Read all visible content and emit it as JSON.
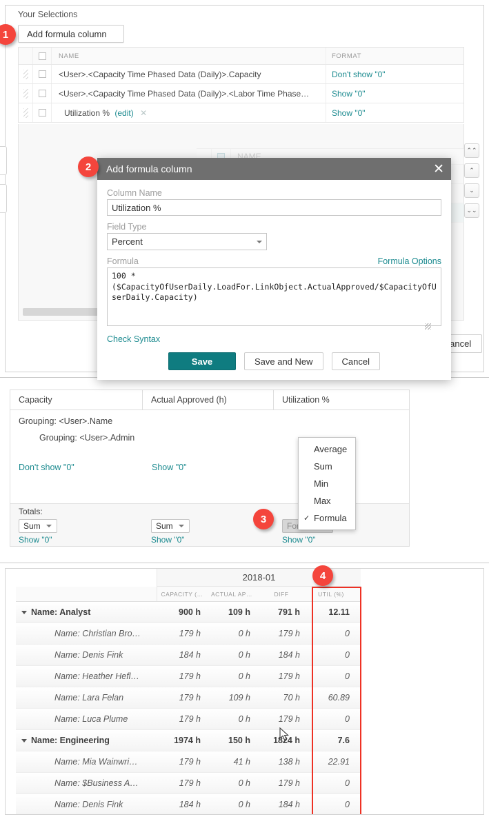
{
  "colors": {
    "accent_teal": "#1b8a8f",
    "save_button": "#0f7c80",
    "badge_red": "#f4453c",
    "highlight_red": "#ee3124",
    "dialog_header": "#6f6f6f"
  },
  "badges": {
    "one": "1",
    "two": "2",
    "three": "3",
    "four": "4"
  },
  "selections": {
    "title": "Your Selections",
    "add_button": "Add formula column",
    "columns": {
      "name": "NAME",
      "format": "FORMAT"
    },
    "rows": [
      {
        "name": "<User>.<Capacity Time Phased Data (Daily)>.Capacity",
        "format": "Don't show \"0\"",
        "edit": "",
        "remove": ""
      },
      {
        "name": "<User>.<Capacity Time Phased Data (Daily)>.<Labor Time Phase…",
        "format": "Show \"0\"",
        "edit": "",
        "remove": ""
      },
      {
        "name": "Utilization %",
        "format": "Show \"0\"",
        "edit": "(edit)",
        "remove": "✕"
      }
    ],
    "ghost_rows": [
      {
        "name": "NAME"
      },
      {
        "name": ""
      },
      {
        "name": ""
      },
      {
        "name": ""
      }
    ],
    "arrows": [
      {
        "glyph": "⌃⌃",
        "name": "move-to-top"
      },
      {
        "glyph": "⌃",
        "name": "move-up"
      },
      {
        "glyph": "⌄",
        "name": "move-down"
      },
      {
        "glyph": "⌄⌄",
        "name": "move-to-bottom"
      }
    ],
    "cancel_button": "Cancel"
  },
  "dialog": {
    "title": "Add formula column",
    "close": "✕",
    "column_name_label": "Column Name",
    "column_name_value": "Utilization %",
    "field_type_label": "Field Type",
    "field_type_value": "Percent",
    "formula_label": "Formula",
    "formula_options_link": "Formula Options",
    "formula_value": "100 *\n($CapacityOfUserDaily.LoadFor.LinkObject.ActualApproved/$CapacityOfUserDaily.Capacity)",
    "check_syntax_link": "Check Syntax",
    "save_label": "Save",
    "save_new_label": "Save and New",
    "cancel_label": "Cancel"
  },
  "totals": {
    "headers": [
      "Capacity",
      "Actual Approved (h)",
      "Utilization %"
    ],
    "grouping_1": "Grouping: <User>.Name",
    "grouping_2": "Grouping: <User>.Admin",
    "format_1": "Don't show \"0\"",
    "format_2": "Show \"0\"",
    "totals_label": "Totals:",
    "combo_1": "Sum",
    "combo_2": "Sum",
    "combo_3": "Formula",
    "show_1": "Show \"0\"",
    "show_2": "Show \"0\"",
    "show_3": "Show \"0\"",
    "dropdown_items": [
      {
        "label": "Average",
        "checked": false
      },
      {
        "label": "Sum",
        "checked": false
      },
      {
        "label": "Min",
        "checked": false
      },
      {
        "label": "Max",
        "checked": false
      },
      {
        "label": "Formula",
        "checked": true
      }
    ],
    "check_glyph": "✓"
  },
  "grid": {
    "period": "2018-01",
    "columns": [
      "CAPACITY (…",
      "ACTUAL AP…",
      "DIFF",
      "UTIL (%)"
    ],
    "rows": [
      {
        "type": "group",
        "name": "Name: Analyst",
        "capacity": "900 h",
        "actual": "109 h",
        "diff": "791 h",
        "util": "12.11"
      },
      {
        "type": "child",
        "name": "Name: Christian Bro…",
        "capacity": "179 h",
        "actual": "0 h",
        "diff": "179 h",
        "util": "0"
      },
      {
        "type": "child",
        "name": "Name: Denis Fink",
        "capacity": "184 h",
        "actual": "0 h",
        "diff": "184 h",
        "util": "0"
      },
      {
        "type": "child",
        "name": "Name: Heather Hefl…",
        "capacity": "179 h",
        "actual": "0 h",
        "diff": "179 h",
        "util": "0"
      },
      {
        "type": "child",
        "name": "Name: Lara Felan",
        "capacity": "179 h",
        "actual": "109 h",
        "diff": "70 h",
        "util": "60.89"
      },
      {
        "type": "child",
        "name": "Name: Luca Plume",
        "capacity": "179 h",
        "actual": "0 h",
        "diff": "179 h",
        "util": "0"
      },
      {
        "type": "group",
        "name": "Name: Engineering",
        "capacity": "1974 h",
        "actual": "150 h",
        "diff": "1824 h",
        "util": "7.6"
      },
      {
        "type": "child",
        "name": "Name: Mia Wainwri…",
        "capacity": "179 h",
        "actual": "41 h",
        "diff": "138 h",
        "util": "22.91"
      },
      {
        "type": "child",
        "name": "Name: $Business A…",
        "capacity": "179 h",
        "actual": "0 h",
        "diff": "179 h",
        "util": "0"
      },
      {
        "type": "child",
        "name": "Name: Denis Fink",
        "capacity": "184 h",
        "actual": "0 h",
        "diff": "184 h",
        "util": "0"
      }
    ]
  }
}
